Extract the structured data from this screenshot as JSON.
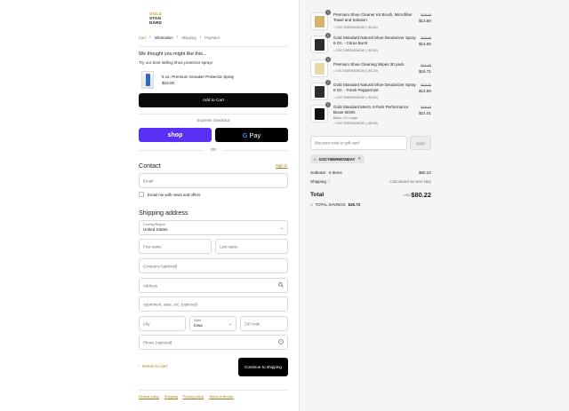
{
  "brand": {
    "line1": "GOLD",
    "line2": "STAN",
    "line3": "DARD"
  },
  "breadcrumb": [
    "Cart",
    "Information",
    "Shipping",
    "Payment"
  ],
  "upsell": {
    "title": "We thought you might like this...",
    "subtitle": "Try our best selling shoe protector spray!",
    "product_name": "5 oz. Premium Sneaker Protector Spray",
    "product_price": "$16.00",
    "add_label": "Add to Cart"
  },
  "express": {
    "label": "Express checkout",
    "shop_label": "shop",
    "gpay_label": "Pay",
    "or_label": "OR"
  },
  "contact": {
    "heading": "Contact",
    "signin": "Sign in",
    "email_placeholder": "Email",
    "newsletter_label": "Email me with news and offers"
  },
  "shipping": {
    "heading": "Shipping address",
    "country_label": "Country/Region",
    "country_value": "United States",
    "first_name": "First name",
    "last_name": "Last name",
    "company": "Company (optional)",
    "address": "Address",
    "apartment": "Apartment, suite, etc. (optional)",
    "city": "City",
    "state_label": "State",
    "state_value": "Iowa",
    "zip": "ZIP code",
    "phone": "Phone (optional)"
  },
  "nav": {
    "return_label": "Return to cart",
    "continue_label": "Continue to shipping"
  },
  "footer_links": [
    "Refund policy",
    "Shipping",
    "Privacy policy",
    "Terms of service"
  ],
  "order": {
    "items": [
      {
        "qty": "1",
        "name": "Premium Shoe Cleaner Kit Brush, Microfiber Towel and Solution",
        "variant": "",
        "discount": "GSCYBERMONDAY (-$4.50)",
        "old_price": "$18.00",
        "price": "$13.50",
        "color": "#d4b36a"
      },
      {
        "qty": "1",
        "name": "Gold Standard Natural Shoe Deodorizer Spray 6 Oz. - Citrus Burst",
        "variant": "",
        "discount": "GSCYBERMONDAY (-$4.50)",
        "old_price": "$18.00",
        "price": "$13.50",
        "color": "#2d2d2d"
      },
      {
        "qty": "1",
        "name": "Premium Shoe Cleaning Wipes 30 pack",
        "variant": "",
        "discount": "GSCYBERMONDAY (-$5.24)",
        "old_price": "$21.95",
        "price": "$16.71",
        "color": "#e8d9a8"
      },
      {
        "qty": "1",
        "name": "Gold Standard Natural Shoe Deodorizer Spray 6 Oz. - Fresh Peppermint",
        "variant": "",
        "discount": "GSCYBERMONDAY (-$4.50)",
        "old_price": "$18.00",
        "price": "$13.50",
        "color": "#2d2d2d"
      },
      {
        "qty": "1",
        "name": "Gold Standard Men's 4-Pack Performance Boxer Briefs",
        "variant": "Black / XX-Large",
        "discount": "GSCYBERMONDAY (-$6.98)",
        "old_price": "$28.00",
        "price": "$21.01",
        "color": "#111111"
      }
    ],
    "discount_placeholder": "Discount code or gift card",
    "apply_label": "Apply",
    "applied_code": "GSCYBERMONDAY",
    "subtotal_label": "Subtotal · 5 items",
    "subtotal_value": "$80.22",
    "shipping_label": "Shipping",
    "shipping_value": "Calculated at next step",
    "total_label": "Total",
    "currency": "USD",
    "total_value": "$80.22",
    "savings_label": "TOTAL SAVINGS",
    "savings_value": "$26.73"
  },
  "colors": {
    "accent": "#9a7d1c",
    "shop_purple": "#5a31f4",
    "button_black": "#0a0a0a"
  }
}
